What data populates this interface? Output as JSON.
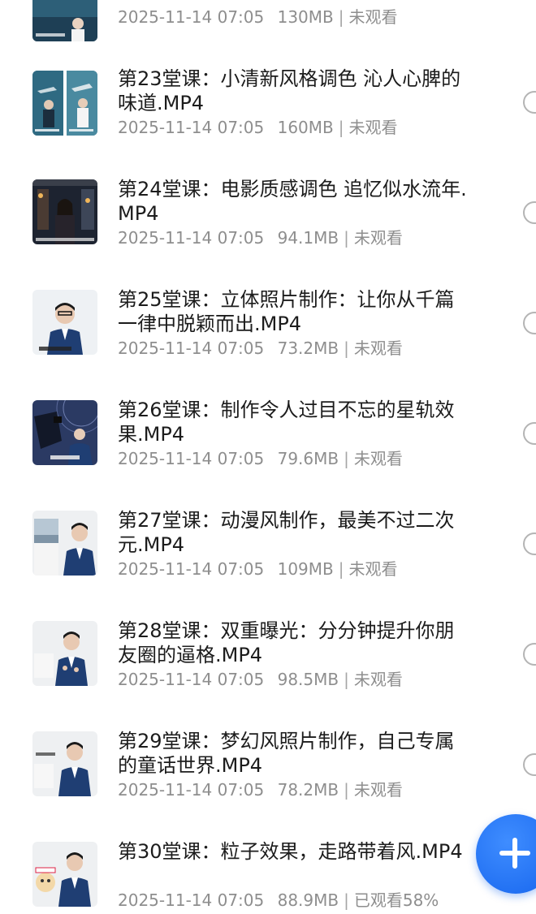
{
  "items": [
    {
      "title": "",
      "date": "2025-11-14 07:05",
      "size": "130MB",
      "status": "未观看",
      "thumb_icon": "aquarium-video-thumbnail"
    },
    {
      "title": "第23堂课：小清新风格调色  沁人心脾的味道.MP4",
      "date": "2025-11-14 07:05",
      "size": "160MB",
      "status": "未观看",
      "thumb_icon": "aquarium-girl-video-thumbnail"
    },
    {
      "title": "第24堂课：电影质感调色  追忆似水流年.MP4",
      "date": "2025-11-14 07:05",
      "size": "94.1MB",
      "status": "未观看",
      "thumb_icon": "night-street-video-thumbnail"
    },
    {
      "title": "第25堂课：立体照片制作：让你从千篇一律中脱颖而出.MP4",
      "date": "2025-11-14 07:05",
      "size": "73.2MB",
      "status": "未观看",
      "thumb_icon": "lecturer-video-thumbnail"
    },
    {
      "title": "第26堂课：制作令人过目不忘的星轨效果.MP4",
      "date": "2025-11-14 07:05",
      "size": "79.6MB",
      "status": "未观看",
      "thumb_icon": "star-trail-video-thumbnail"
    },
    {
      "title": "第27堂课：动漫风制作，最美不过二次元.MP4",
      "date": "2025-11-14 07:05",
      "size": "109MB",
      "status": "未观看",
      "thumb_icon": "lecturer-video-thumbnail"
    },
    {
      "title": "第28堂课：双重曝光：分分钟提升你朋友圈的逼格.MP4",
      "date": "2025-11-14 07:05",
      "size": "98.5MB",
      "status": "未观看",
      "thumb_icon": "lecturer-video-thumbnail"
    },
    {
      "title": "第29堂课：梦幻风照片制作，自己专属的童话世界.MP4",
      "date": "2025-11-14 07:05",
      "size": "78.2MB",
      "status": "未观看",
      "thumb_icon": "lecturer-video-thumbnail"
    },
    {
      "title": "第30堂课：粒子效果，走路带着风.MP4",
      "date": "2025-11-14 07:05",
      "size": "88.9MB",
      "status": "已观看58%",
      "thumb_icon": "lecturer-video-thumbnail"
    }
  ],
  "fab": {
    "icon": "plus-icon"
  },
  "colors": {
    "accent": "#1766ee",
    "title": "#1c1c1c",
    "meta": "#8e8e8e"
  }
}
